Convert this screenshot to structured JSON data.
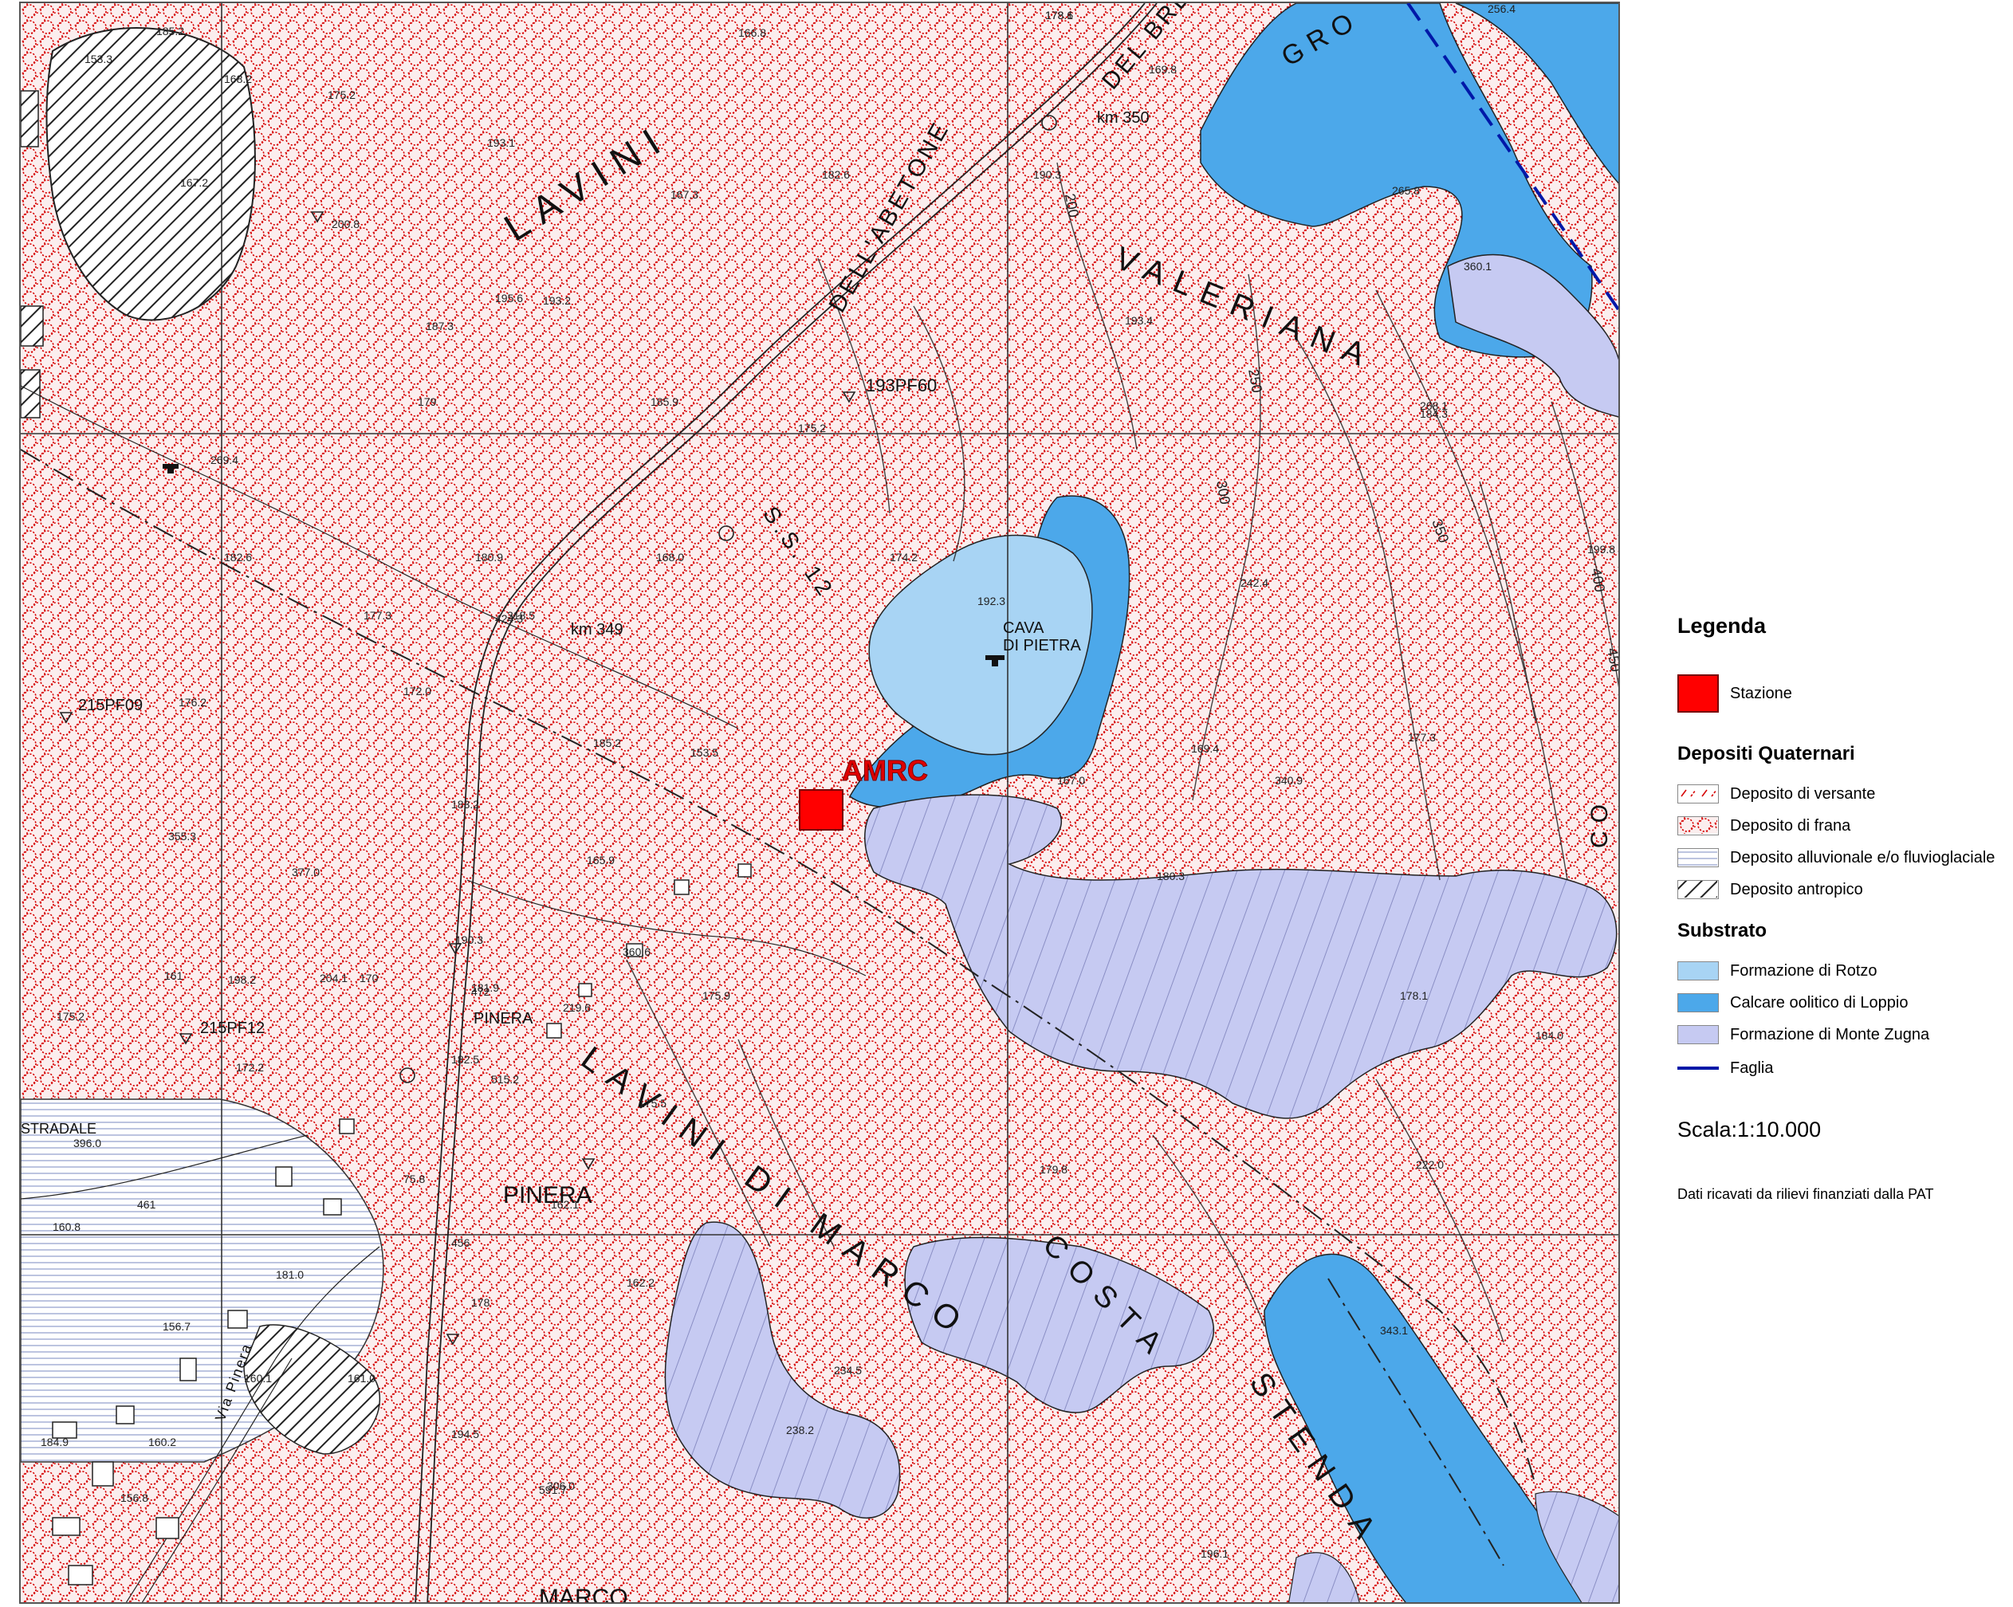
{
  "map": {
    "place_labels": [
      {
        "id": "lavini",
        "text": "LAVINI"
      },
      {
        "id": "valeriana",
        "text": "VALERIANA"
      },
      {
        "id": "gro",
        "text": "GRO"
      },
      {
        "id": "dell-abetone",
        "text": "DELL'ABETONE"
      },
      {
        "id": "del-bre",
        "text": "DEL BRE"
      },
      {
        "id": "cava",
        "text": "CAVA"
      },
      {
        "id": "di-pietra",
        "text": "DI PIETRA"
      },
      {
        "id": "pinera-small",
        "text": "PINERA"
      },
      {
        "id": "pinera",
        "text": "PINERA"
      },
      {
        "id": "lavini-di-marco",
        "text": "LAVINI DI MARCO"
      },
      {
        "id": "costa",
        "text": "COSTA"
      },
      {
        "id": "stenda",
        "text": "STENDA"
      },
      {
        "id": "marco",
        "text": "MARCO"
      },
      {
        "id": "stradale",
        "text": "STRADALE"
      },
      {
        "id": "via-pinera",
        "text": "Via Pinera"
      },
      {
        "id": "ss12",
        "text": "S.S. 12"
      },
      {
        "id": "km350",
        "text": "km 350"
      },
      {
        "id": "km349",
        "text": "km 349"
      },
      {
        "id": "pf193",
        "text": "193PF60"
      },
      {
        "id": "pf215a",
        "text": "215PF09"
      },
      {
        "id": "pf215b",
        "text": "215PF12"
      },
      {
        "id": "co",
        "text": "CO"
      }
    ],
    "station": {
      "code": "AMRC",
      "color": "#ff0000"
    },
    "spot_heights": [
      "173.6",
      "185.2",
      "166.8",
      "256.4",
      "153.3",
      "168.2",
      "175.2",
      "167.2",
      "193.1",
      "167.3",
      "182.6",
      "190.3",
      "200.8",
      "195.6",
      "265.8",
      "360.1",
      "169.8",
      "193.2",
      "187.3",
      "179",
      "185.9",
      "175.2",
      "193.4",
      "184.3",
      "268.1",
      "269.4",
      "182.6",
      "180.9",
      "168.0",
      "174.2",
      "192.3",
      "242.4",
      "199.8",
      "318.5",
      "424.3",
      "177.3",
      "172.0",
      "176.2",
      "185.2",
      "153.5",
      "169.4",
      "177.3",
      "340.9",
      "355.3",
      "377.0",
      "165.9",
      "183.2",
      "180.3",
      "190.3",
      "360.6",
      "175.9",
      "219.6",
      "198.2",
      "204.1",
      "178.1",
      "184.0",
      "472",
      "515.2",
      "175.5",
      "179.8",
      "222.0",
      "396.0",
      "461",
      "160.8",
      "181.0",
      "156.7",
      "184.9",
      "160.2",
      "156.8",
      "160.1",
      "161.0",
      "162.1",
      "162.2",
      "234.5",
      "238.2",
      "343.1",
      "306.0",
      "591.7",
      "196.1",
      "194.5",
      "456",
      "178",
      "181.9",
      "182.5",
      "175.2",
      "170",
      "75.8",
      "172.2",
      "167.0",
      "161",
      "178.1"
    ],
    "contour_labels": [
      "200",
      "250",
      "300",
      "350",
      "400",
      "450"
    ],
    "colors": {
      "background": "#f4e6e6",
      "hatch_red": "#d60000",
      "rotzo": "#a8d4f4",
      "loppio": "#4ca8ea",
      "zugna": "#c6caf2",
      "faglia": "#0018a8",
      "grid": "#333333",
      "contour": "#222222"
    }
  },
  "legend": {
    "title": "Legenda",
    "station_label": "Stazione",
    "quaternary_heading": "Depositi Quaternari",
    "quaternary_items": [
      "Deposito di versante",
      "Deposito di frana",
      "Deposito alluvionale e/o fluvioglaciale",
      "Deposito antropico"
    ],
    "substrate_heading": "Substrato",
    "substrate_items": [
      "Formazione di Rotzo",
      "Calcare oolitico di Loppio",
      "Formazione di Monte Zugna"
    ],
    "fault_label": "Faglia",
    "scale_label": "Scala:",
    "scale_value": "1:10.000",
    "note": "Dati ricavati da rilievi finanziati dalla PAT"
  }
}
